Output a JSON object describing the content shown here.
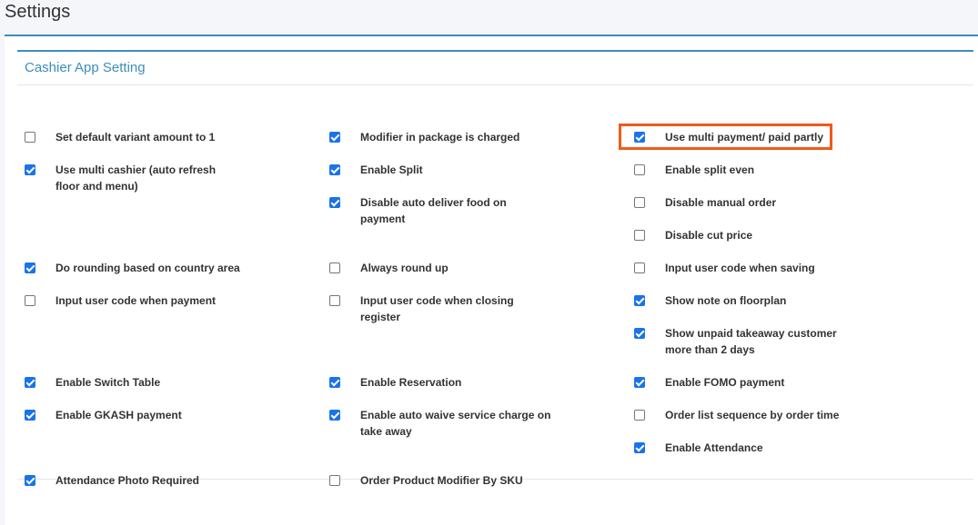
{
  "page": {
    "title": "Settings"
  },
  "section": {
    "title": "Cashier App Setting"
  },
  "colors": {
    "accent": "#3c8dbc",
    "checkbox_checked": "#1a73e8",
    "highlight": "#f05a1a"
  },
  "options": {
    "o1": {
      "label": "Set default variant amount to 1",
      "checked": false
    },
    "o2": {
      "label": "Modifier in package is charged",
      "checked": true
    },
    "o3": {
      "label": "Use multi payment/ paid partly",
      "checked": true
    },
    "o4": {
      "label": "Use multi cashier (auto refresh floor and menu)",
      "checked": true
    },
    "o5": {
      "label": "Enable Split",
      "checked": true
    },
    "o6": {
      "label": "Enable split even",
      "checked": false
    },
    "o7": {
      "label": "Disable auto deliver food on payment",
      "checked": true
    },
    "o8": {
      "label": "Disable manual order",
      "checked": false
    },
    "o9": {
      "label": "Disable cut price",
      "checked": false
    },
    "o10": {
      "label": "Do rounding based on country area",
      "checked": true
    },
    "o11": {
      "label": "Always round up",
      "checked": false
    },
    "o12": {
      "label": "Input user code when saving",
      "checked": false
    },
    "o13": {
      "label": "Input user code when payment",
      "checked": false
    },
    "o14": {
      "label": "Input user code when closing register",
      "checked": false
    },
    "o15": {
      "label": "Show note on floorplan",
      "checked": true
    },
    "o16": {
      "label": "Show unpaid takeaway customer more than 2 days",
      "checked": true
    },
    "o17": {
      "label": "Enable Switch Table",
      "checked": true
    },
    "o18": {
      "label": "Enable Reservation",
      "checked": true
    },
    "o19": {
      "label": "Enable FOMO payment",
      "checked": true
    },
    "o20": {
      "label": "Enable GKASH payment",
      "checked": true
    },
    "o21": {
      "label": "Enable auto waive service charge on take away",
      "checked": true
    },
    "o22": {
      "label": "Order list sequence by order time",
      "checked": false
    },
    "o23": {
      "label": "Enable Attendance",
      "checked": true
    },
    "o24": {
      "label": "Attendance Photo Required",
      "checked": true
    },
    "o25": {
      "label": "Order Product Modifier By SKU",
      "checked": false
    }
  }
}
